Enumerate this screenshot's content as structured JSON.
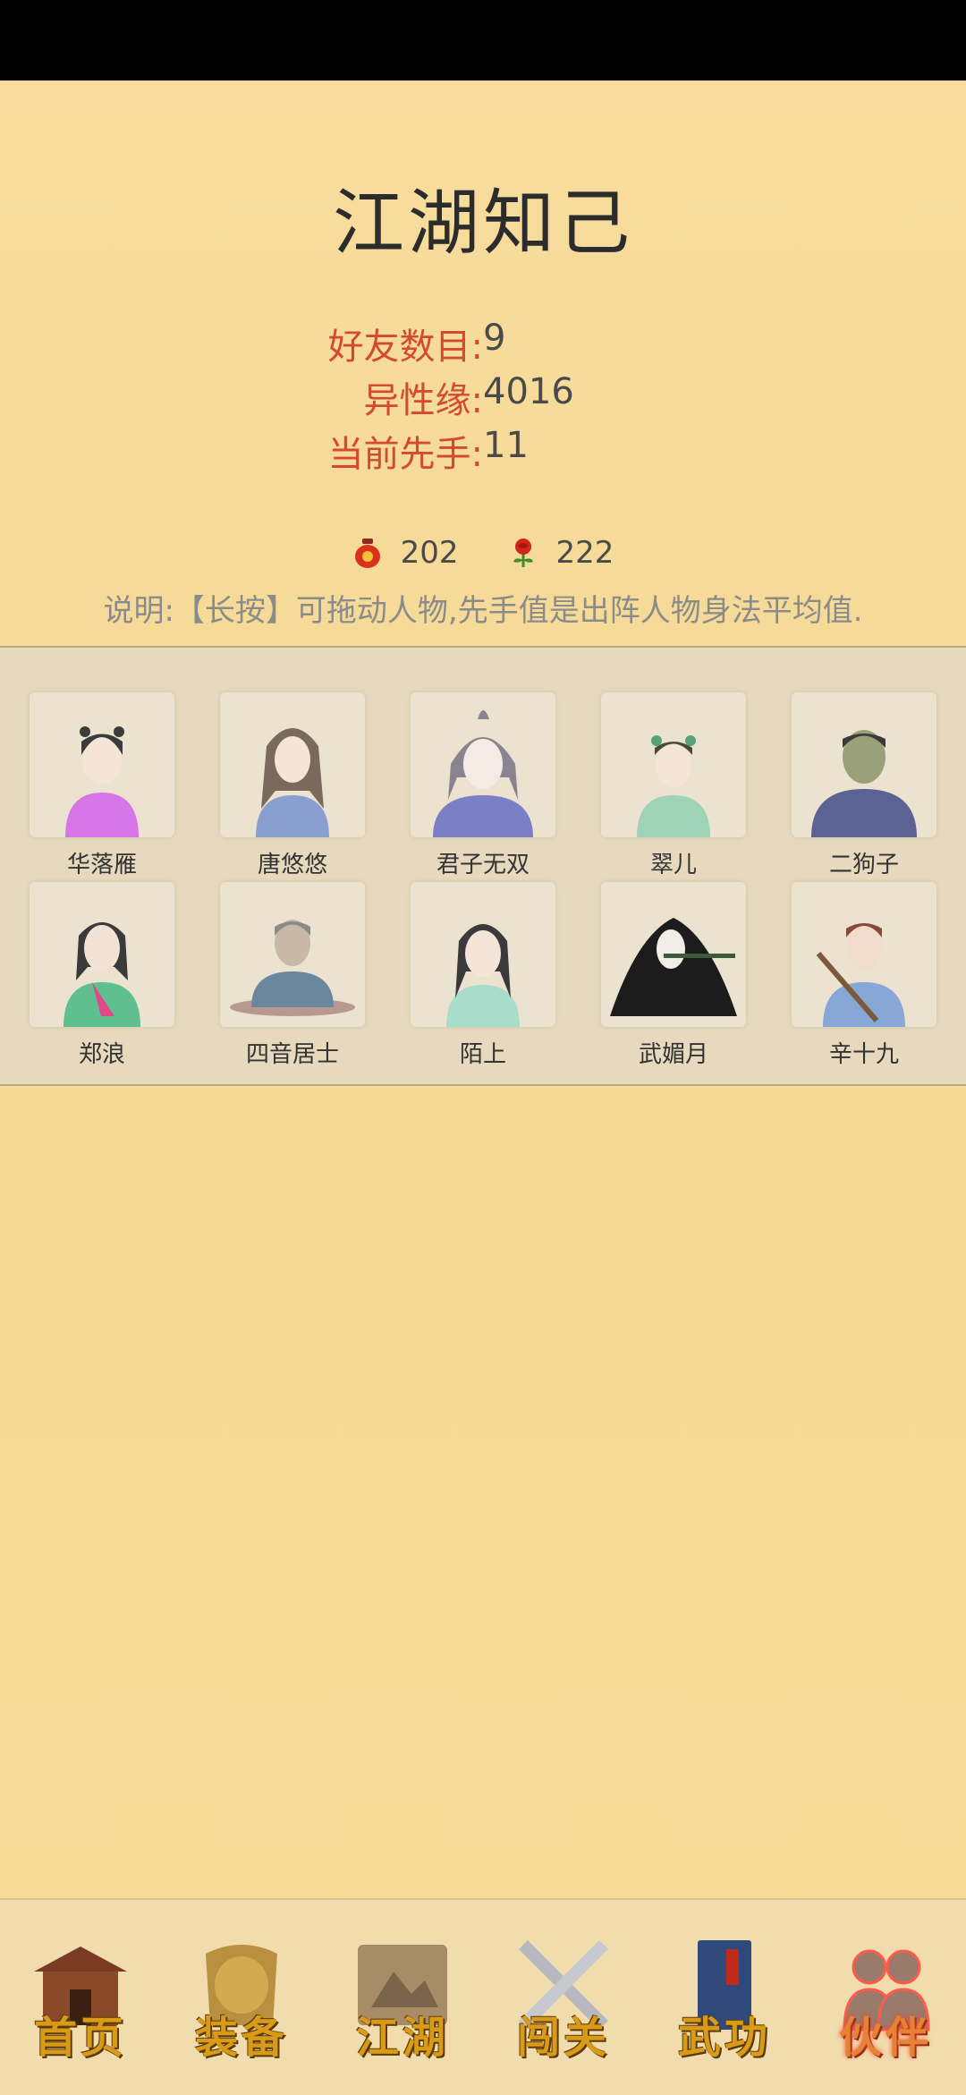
{
  "title": "江湖知己",
  "stats": [
    {
      "label": "好友数目:",
      "value": "9"
    },
    {
      "label": "异性缘:",
      "value": "4016"
    },
    {
      "label": "当前先手:",
      "value": "11"
    }
  ],
  "currency": {
    "wine": {
      "icon": "wine-jar-icon",
      "value": "202"
    },
    "rose": {
      "icon": "rose-icon",
      "value": "222"
    }
  },
  "note": "说明:【长按】可拖动人物,先手值是出阵人物身法平均值.",
  "friends": [
    {
      "name": "华落雁",
      "icon": "portrait-hua-luoyan"
    },
    {
      "name": "唐悠悠",
      "icon": "portrait-tang-youyou"
    },
    {
      "name": "君子无双",
      "icon": "portrait-junzi-wushuang"
    },
    {
      "name": "翠儿",
      "icon": "portrait-cuier"
    },
    {
      "name": "二狗子",
      "icon": "portrait-ergouzi"
    },
    {
      "name": "郑浪",
      "icon": "portrait-zheng-lang"
    },
    {
      "name": "四音居士",
      "icon": "portrait-siyin-jushi"
    },
    {
      "name": "陌上",
      "icon": "portrait-moshang"
    },
    {
      "name": "武媚月",
      "icon": "portrait-wu-meiyue"
    },
    {
      "name": "辛十九",
      "icon": "portrait-xin-shijiu"
    }
  ],
  "nav": [
    {
      "label": "首页",
      "icon": "house-icon"
    },
    {
      "label": "装备",
      "icon": "armor-icon"
    },
    {
      "label": "江湖",
      "icon": "scroll-map-icon"
    },
    {
      "label": "闯关",
      "icon": "crossed-swords-icon"
    },
    {
      "label": "武功",
      "icon": "book-icon"
    },
    {
      "label": "伙伴",
      "icon": "companions-icon",
      "active": true
    }
  ],
  "colors": {
    "accent": "#d44a30",
    "background": "#f6dd9e",
    "panel": "#e6d9bd",
    "nav_gold": "#d89a17"
  }
}
